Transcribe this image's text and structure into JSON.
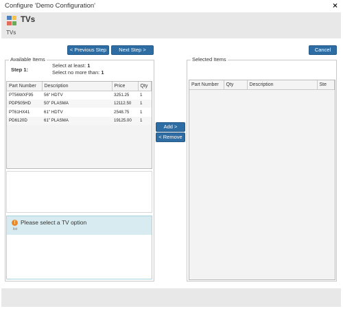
{
  "window": {
    "title": "Configure 'Demo Configuration'",
    "close_label": "×"
  },
  "header": {
    "icon": "tv-config-icon",
    "title": "TVs",
    "subtitle": "TVs"
  },
  "nav": {
    "prev_label": "< Previous Step",
    "next_label": "Next Step >",
    "cancel_label": "Cancel"
  },
  "available": {
    "legend": "Available Items",
    "step_label": "Step 1:",
    "min_text": "Select at least:",
    "min_value": "1",
    "max_text": "Select no more than:",
    "max_value": "1",
    "columns": [
      "Part Number",
      "Description",
      "Price",
      "Qty"
    ],
    "rows": [
      {
        "part": "PT56WXF95",
        "desc": "56\" HDTV",
        "price": "3251.25",
        "qty": "1"
      },
      {
        "part": "PDP505HD",
        "desc": "50\" PLASMA",
        "price": "12112.50",
        "qty": "1"
      },
      {
        "part": "PT61HX41",
        "desc": "61\" HDTV",
        "price": "2548.75",
        "qty": "1"
      },
      {
        "part": "PD6120D",
        "desc": "61\" PLASMA",
        "price": "19125.00",
        "qty": "1"
      }
    ]
  },
  "actions": {
    "add_label": "Add >",
    "remove_label": "< Remove"
  },
  "message": {
    "text": "Please select a TV option",
    "icon": "warning-icon",
    "sub": "list"
  },
  "selected": {
    "legend": "Selected Items",
    "columns": [
      "Part Number",
      "Qty",
      "Description",
      "Ste"
    ]
  },
  "colors": {
    "button": "#2e6da4",
    "header_bg": "#e8e8e8",
    "message_bg": "#d7ebf1",
    "warning": "#e8892c"
  }
}
